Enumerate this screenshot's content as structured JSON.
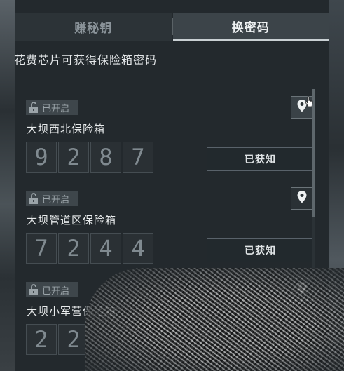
{
  "tabs": [
    {
      "label": "赚秘钥",
      "active": false
    },
    {
      "label": "换密码",
      "active": true
    }
  ],
  "subtitle": "花费芯片可获得保险箱密码",
  "safes": [
    {
      "status": "已开启",
      "name": "大坝西北保险箱",
      "digits": [
        "9",
        "2",
        "8",
        "7"
      ],
      "action": "已获知"
    },
    {
      "status": "已开启",
      "name": "大坝管道区保险箱",
      "digits": [
        "7",
        "2",
        "4",
        "4"
      ],
      "action": "已获知"
    },
    {
      "status": "已开启",
      "name": "大坝小军营保险箱",
      "digits": [
        "2",
        "2"
      ],
      "action": ""
    }
  ],
  "icons": {
    "lock": "unlock-icon",
    "location": "map-pin-icon"
  },
  "colors": {
    "panel": "#23292d",
    "accent": "#e8ebec"
  }
}
